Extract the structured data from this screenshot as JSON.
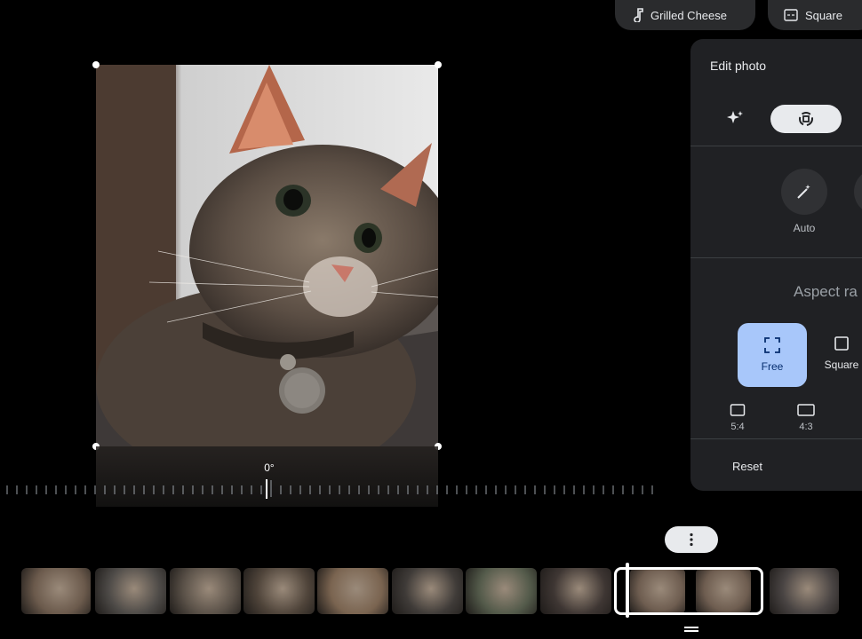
{
  "top_chips": {
    "music": {
      "label": "Grilled Cheese",
      "icon": "music-note-icon"
    },
    "format": {
      "label": "Square",
      "icon": "aspect-icon"
    }
  },
  "editor": {
    "rotation_label": "0°"
  },
  "panel": {
    "title": "Edit photo",
    "tools": [
      {
        "icon": "sparkle-icon",
        "selected": false
      },
      {
        "icon": "crop-rotate-icon",
        "selected": true
      }
    ],
    "auto_label": "Auto",
    "aspect_title": "Aspect ra",
    "aspect_options": [
      {
        "label": "Free",
        "icon": "free-crop-icon",
        "selected": true
      },
      {
        "label": "Square",
        "icon": "square-icon",
        "selected": false
      }
    ],
    "ratios": [
      {
        "label": "5:4",
        "icon": "ratio-icon"
      },
      {
        "label": "4:3",
        "icon": "ratio-icon"
      }
    ],
    "reset_label": "Reset"
  },
  "filmstrip": {
    "more_icon": "more-vert-icon",
    "thumbs": [
      {
        "color": "#6b5a4c"
      },
      {
        "color": "#4d4a47"
      },
      {
        "color": "#5a5148"
      },
      {
        "color": "#4f443a"
      },
      {
        "color": "#7a6450"
      },
      {
        "color": "#3f3b38"
      },
      {
        "color": "#535a4a"
      },
      {
        "color": "#3e3633"
      },
      {
        "color": "#6e5d50"
      },
      {
        "color": "#6e5d50"
      },
      {
        "color": "#494443"
      }
    ]
  }
}
